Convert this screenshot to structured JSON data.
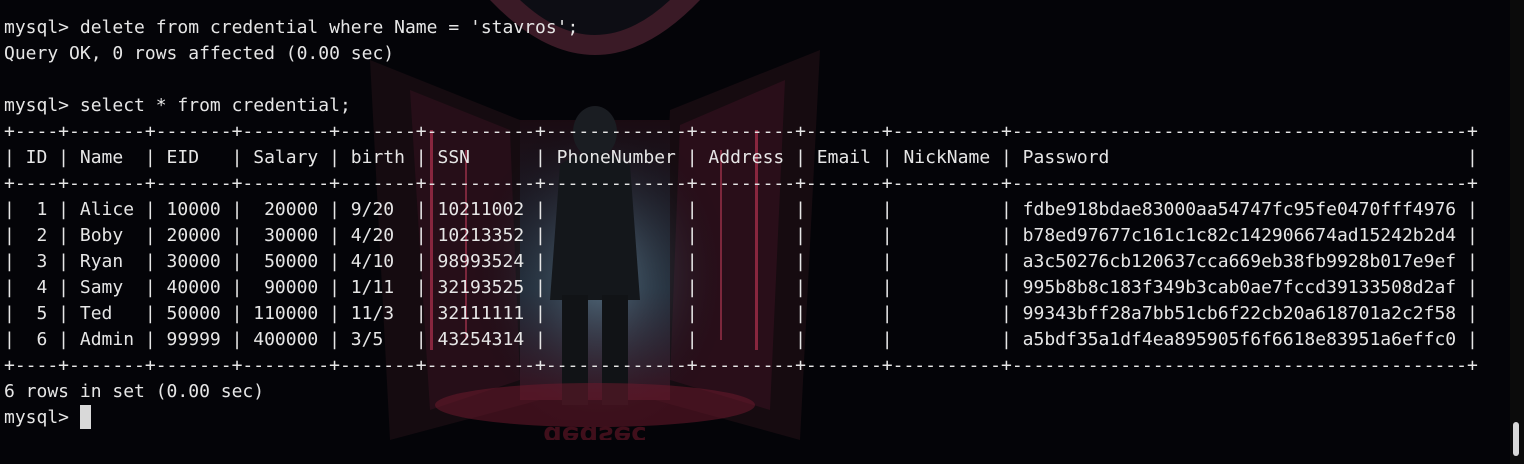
{
  "terminal": {
    "lines": [
      "mysql> delete from credential where Name = 'stavros';",
      "Query OK, 0 rows affected (0.00 sec)",
      "",
      "mysql> select * from credential;",
      "+----+-------+-------+--------+-------+----------+-------------+---------+-------+----------+------------------------------------------+",
      "| ID | Name  | EID   | Salary | birth | SSN      | PhoneNumber | Address | Email | NickName | Password                                 |",
      "+----+-------+-------+--------+-------+----------+-------------+---------+-------+----------+------------------------------------------+",
      "|  1 | Alice | 10000 |  20000 | 9/20  | 10211002 |             |         |       |          | fdbe918bdae83000aa54747fc95fe0470fff4976 |",
      "|  2 | Boby  | 20000 |  30000 | 4/20  | 10213352 |             |         |       |          | b78ed97677c161c1c82c142906674ad15242b2d4 |",
      "|  3 | Ryan  | 30000 |  50000 | 4/10  | 98993524 |             |         |       |          | a3c50276cb120637cca669eb38fb9928b017e9ef |",
      "|  4 | Samy  | 40000 |  90000 | 1/11  | 32193525 |             |         |       |          | 995b8b8c183f349b3cab0ae7fccd39133508d2af |",
      "|  5 | Ted   | 50000 | 110000 | 11/3  | 32111111 |             |         |       |          | 99343bff28a7bb51cb6f22cb20a618701a2c2f58 |",
      "|  6 | Admin | 99999 | 400000 | 3/5   | 43254314 |             |         |       |          | a5bdf35a1df4ea895905f6f6618e83951a6effc0 |",
      "+----+-------+-------+--------+-------+----------+-------------+---------+-------+----------+------------------------------------------+",
      "6 rows in set (0.00 sec)",
      ""
    ],
    "prompt": "mysql> "
  },
  "colors": {
    "background": "#040408",
    "text": "#e6e6e6",
    "cursor": "#d9d9d9",
    "scrollbar_thumb": "#d8d8d8"
  },
  "wallpaper": {
    "icon": "hooded-figure-alley-wallpaper",
    "mirrored_text": "dedsec"
  }
}
